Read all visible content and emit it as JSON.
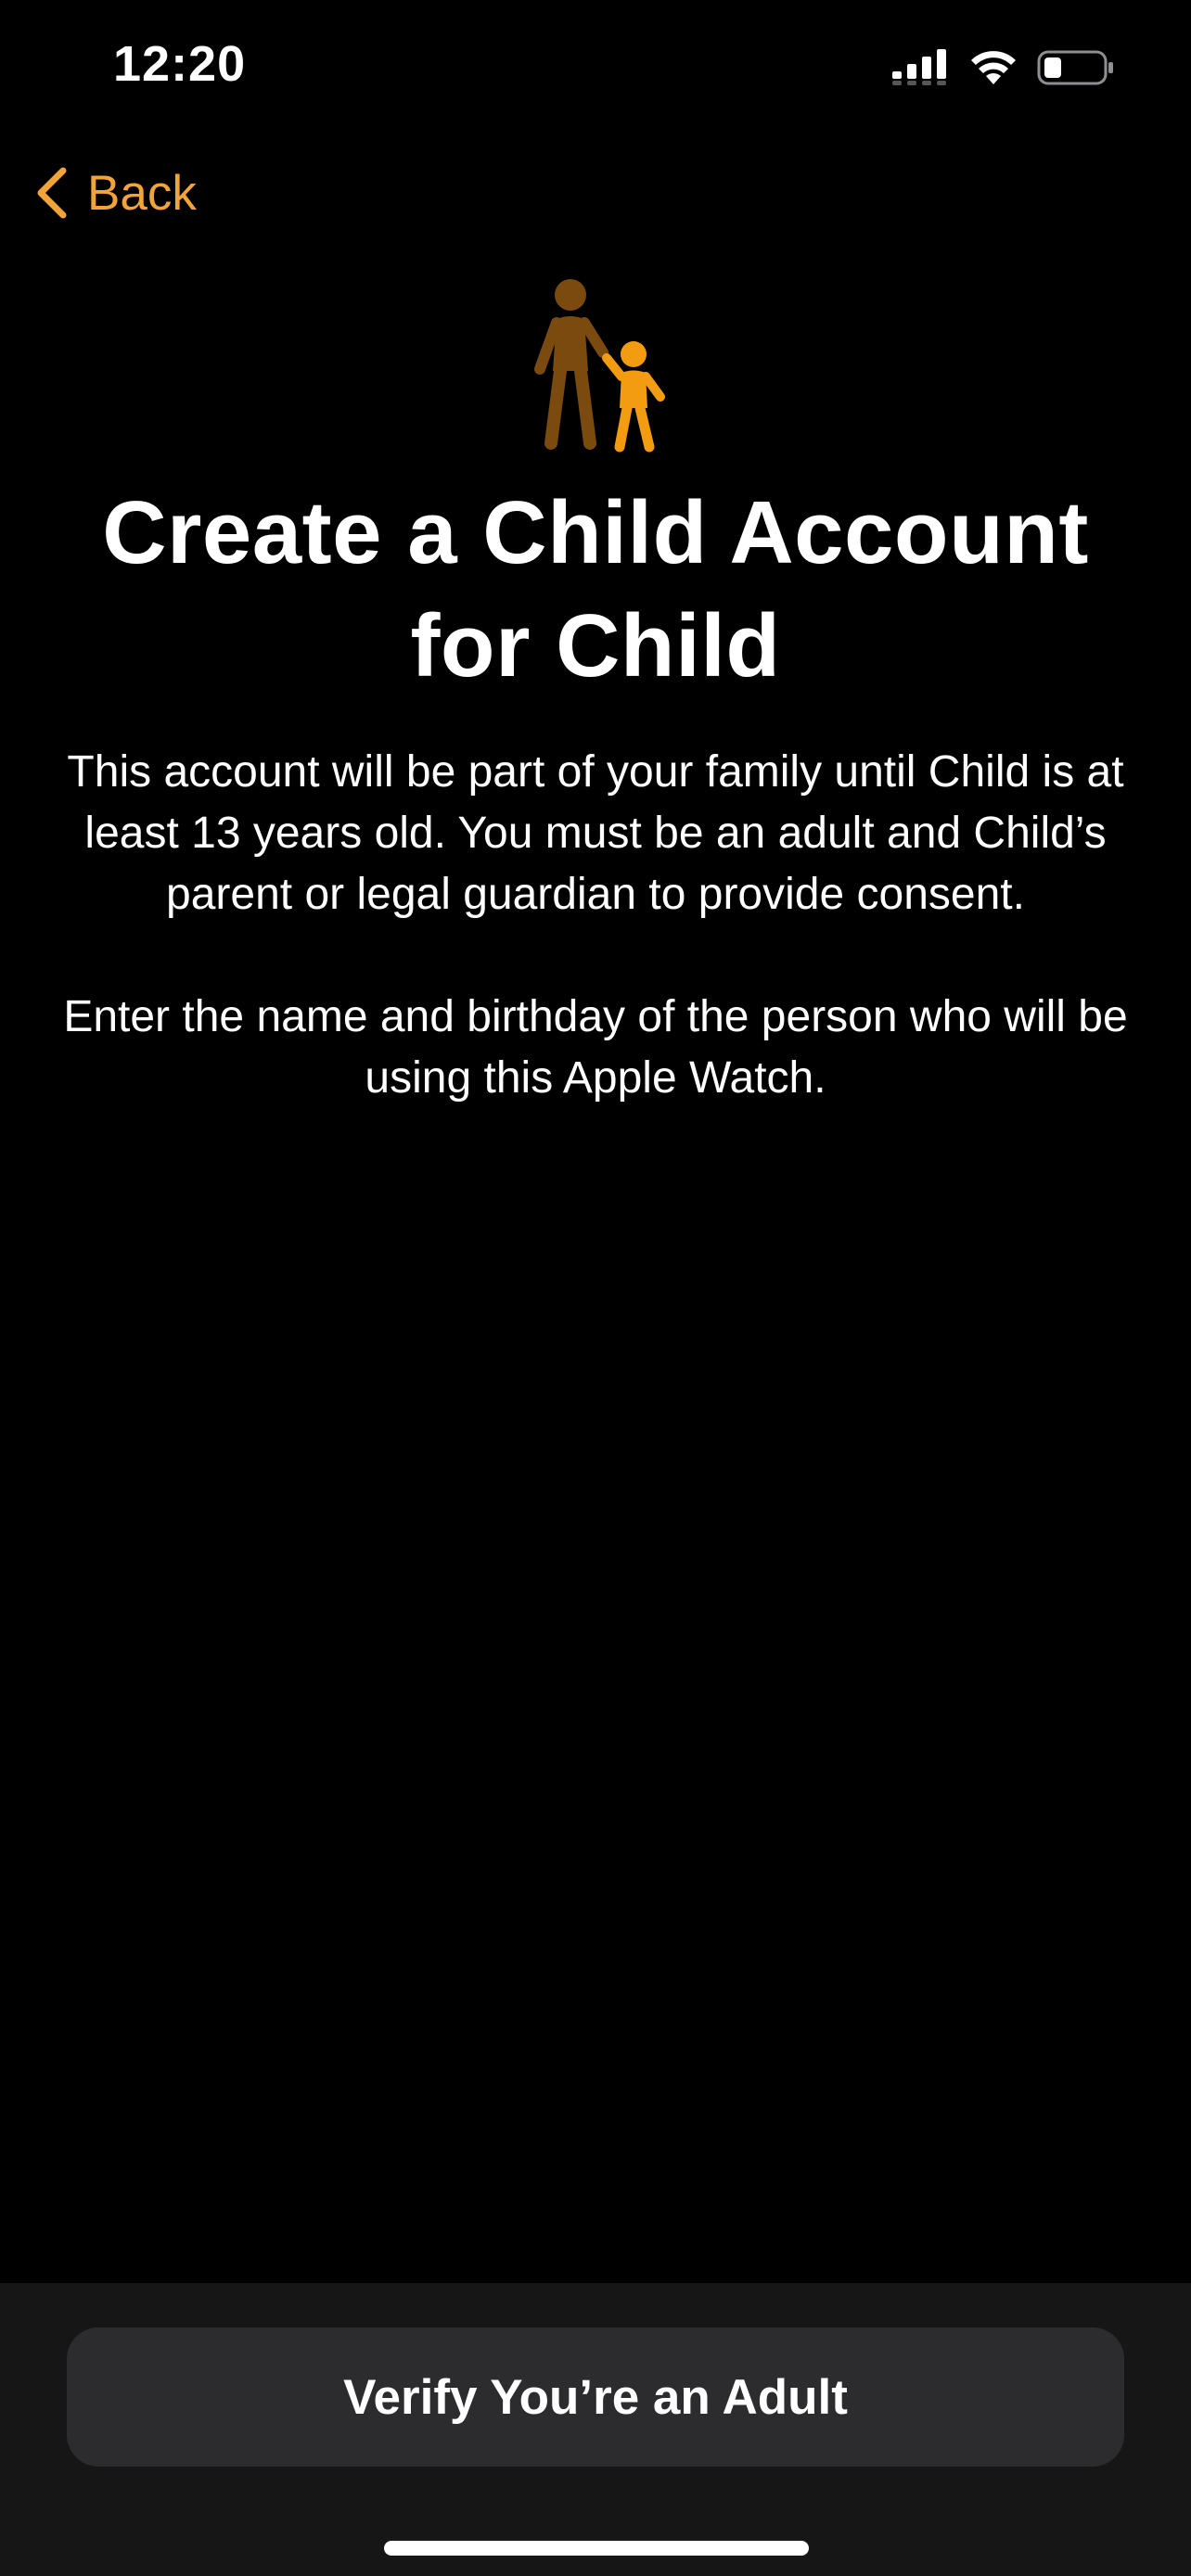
{
  "status_bar": {
    "time": "12:20",
    "icons": [
      "cellular-signal-icon",
      "wifi-icon",
      "battery-icon"
    ]
  },
  "nav": {
    "back_label": "Back",
    "back_icon": "chevron-left-icon"
  },
  "hero": {
    "icon": "parent-and-child-icon",
    "colors": {
      "adult": "#7A4A0E",
      "child": "#F39C12"
    }
  },
  "title": "Create a Child Account for Child",
  "paragraphs": [
    "This account will be part of your family until Child is at least 13 years old. You must be an adult and Child’s parent or legal guardian to provide consent.",
    "Enter the name and birthday of the person who will be using this Apple Watch."
  ],
  "primary_button": {
    "label": "Verify You’re an Adult"
  },
  "colors": {
    "accent": "#F2A33A",
    "background": "#000000",
    "panel": "#161616",
    "button": "#2C2C2E"
  }
}
